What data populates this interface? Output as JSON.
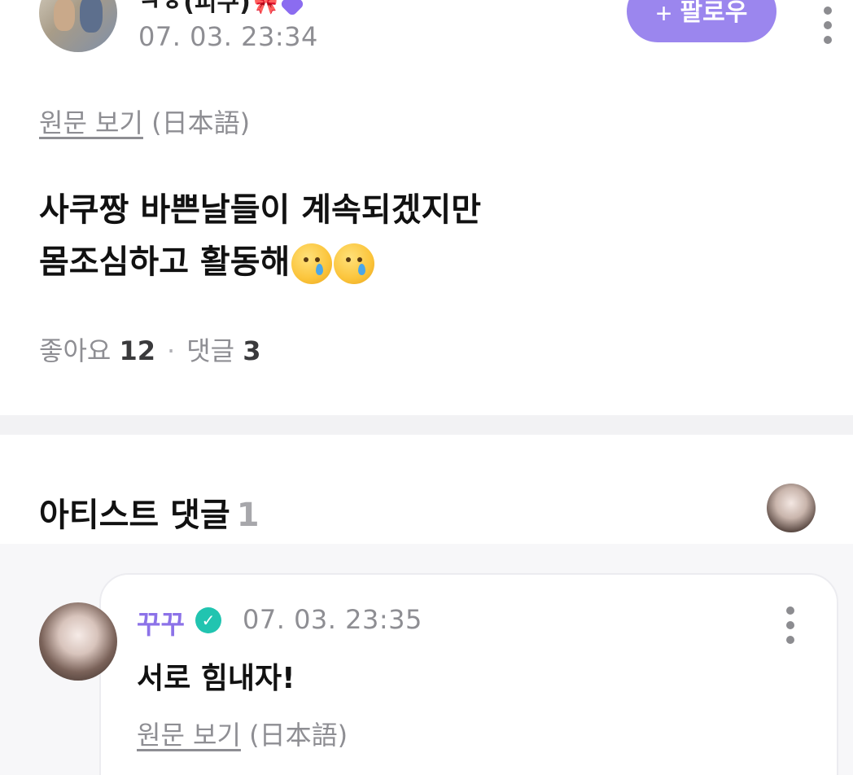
{
  "post": {
    "author_name": "ㅋㅎ(피쿠)",
    "author_emoji": "🎀",
    "time": "07. 03. 23:34",
    "follow_label": "팔로우",
    "original_link": "원문 보기",
    "original_lang": "(日本語)",
    "text_line1": "사쿠짱 바쁜날들이 계속되겠지만",
    "text_line2": "몸조심하고 활동해",
    "likes_label": "좋아요",
    "likes_count": "12",
    "comments_label": "댓글",
    "comments_count": "3"
  },
  "artist_comments": {
    "title": "아티스트 댓글",
    "count": "1",
    "comment": {
      "author_name": "꾸꾸",
      "time": "07. 03. 23:35",
      "text": "서로 힘내자!",
      "original_link": "원문 보기",
      "original_lang": "(日本語)"
    }
  },
  "colors": {
    "accent": "#9b86ee",
    "artist_name": "#8c72e8",
    "verified": "#21c4b0",
    "muted": "#8e8e93"
  },
  "icons": [
    "plus-icon",
    "more-vertical-icon",
    "verified-badge-icon",
    "crying-face-emoji"
  ]
}
